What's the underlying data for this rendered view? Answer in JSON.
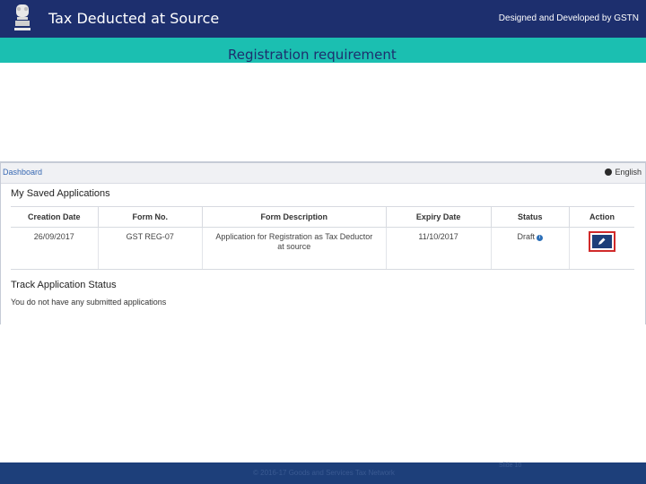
{
  "header": {
    "title": "Tax Deducted at Source",
    "credit": "Designed and Developed by GSTN",
    "emblem_icon": "emblem-icon"
  },
  "band": {
    "title": "Registration requirement"
  },
  "portal": {
    "breadcrumb": "Dashboard",
    "language": "English",
    "saved_title": "My Saved Applications",
    "columns": [
      "Creation Date",
      "Form No.",
      "Form Description",
      "Expiry Date",
      "Status",
      "Action"
    ],
    "rows": [
      {
        "creation_date": "26/09/2017",
        "form_no": "GST REG-07",
        "description_line1": "Application for Registration as Tax Deductor",
        "description_line2": "at source",
        "expiry_date": "11/10/2017",
        "status": "Draft",
        "action_icon": "edit-icon"
      }
    ],
    "track_title": "Track Application Status",
    "empty_message": "You do not have any submitted applications"
  },
  "footer": {
    "copyright": "© 2016-17 Goods and Services Tax Network",
    "page": "Slide 10"
  },
  "colors": {
    "header_bg": "#1d2f6e",
    "band_bg": "#1bbfb1",
    "footer_bg": "#1d3f7a",
    "highlight": "#d12a2a"
  }
}
